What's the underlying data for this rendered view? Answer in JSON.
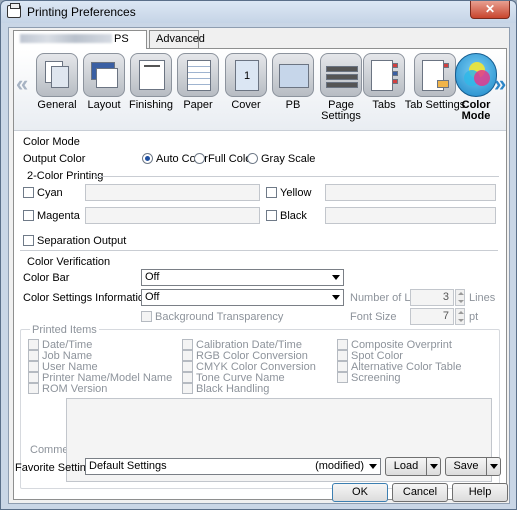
{
  "window": {
    "title": "Printing Preferences",
    "close_label": "✕"
  },
  "tabs": {
    "printer_suffix": "PS",
    "advanced": "Advanced"
  },
  "toolbar": {
    "items": [
      {
        "label": "General",
        "icon": "general-icon"
      },
      {
        "label": "Layout",
        "icon": "layout-icon"
      },
      {
        "label": "Finishing",
        "icon": "finishing-icon"
      },
      {
        "label": "Paper",
        "icon": "paper-icon"
      },
      {
        "label": "Cover",
        "icon": "cover-icon"
      },
      {
        "label": "PB",
        "icon": "pb-icon"
      },
      {
        "label": "Page Settings",
        "icon": "page-settings-icon"
      },
      {
        "label": "Tabs",
        "icon": "tabs-icon"
      },
      {
        "label": "Tab Settings",
        "icon": "tab-settings-icon"
      },
      {
        "label": "Color",
        "label2": "Mode",
        "icon": "color-mode-icon"
      }
    ],
    "left_arrow": "«",
    "right_arrow": "»",
    "cover_glyph": "1"
  },
  "color_mode": {
    "section_title": "Color Mode",
    "output_color_label": "Output Color",
    "options": [
      "Auto Color",
      "Full Color",
      "Gray Scale"
    ],
    "selected": "Auto Color"
  },
  "two_color": {
    "title": "2-Color Printing",
    "items": [
      "Cyan",
      "Magenta",
      "Yellow",
      "Black"
    ]
  },
  "separation_output": "Separation Output",
  "color_verification": {
    "title": "Color Verification",
    "color_bar_label": "Color Bar",
    "color_bar_value": "Off",
    "settings_info_label": "Color Settings Information",
    "settings_info_value": "Off",
    "number_of_lines_label": "Number of Lines",
    "number_of_lines_value": "3",
    "lines_unit": "Lines",
    "font_size_label": "Font Size",
    "font_size_value": "7",
    "font_unit": "pt",
    "background_transparency": "Background Transparency"
  },
  "printed_items": {
    "title": "Printed Items",
    "col1": [
      "Date/Time",
      "Job Name",
      "User Name",
      "Printer Name/Model Name",
      "ROM Version"
    ],
    "col2": [
      "Calibration Date/Time",
      "RGB Color Conversion",
      "CMYK Color Conversion",
      "Tone Curve Name",
      "Black Handling"
    ],
    "col3": [
      "Composite Overprint",
      "Spot Color",
      "Alternative Color Table",
      "Screening"
    ],
    "comment_label": "Comment"
  },
  "favorite": {
    "label": "Favorite Setting",
    "value": "Default Settings",
    "state": "(modified)",
    "load": "Load",
    "save": "Save"
  },
  "buttons": {
    "ok": "OK",
    "cancel": "Cancel",
    "help": "Help"
  }
}
